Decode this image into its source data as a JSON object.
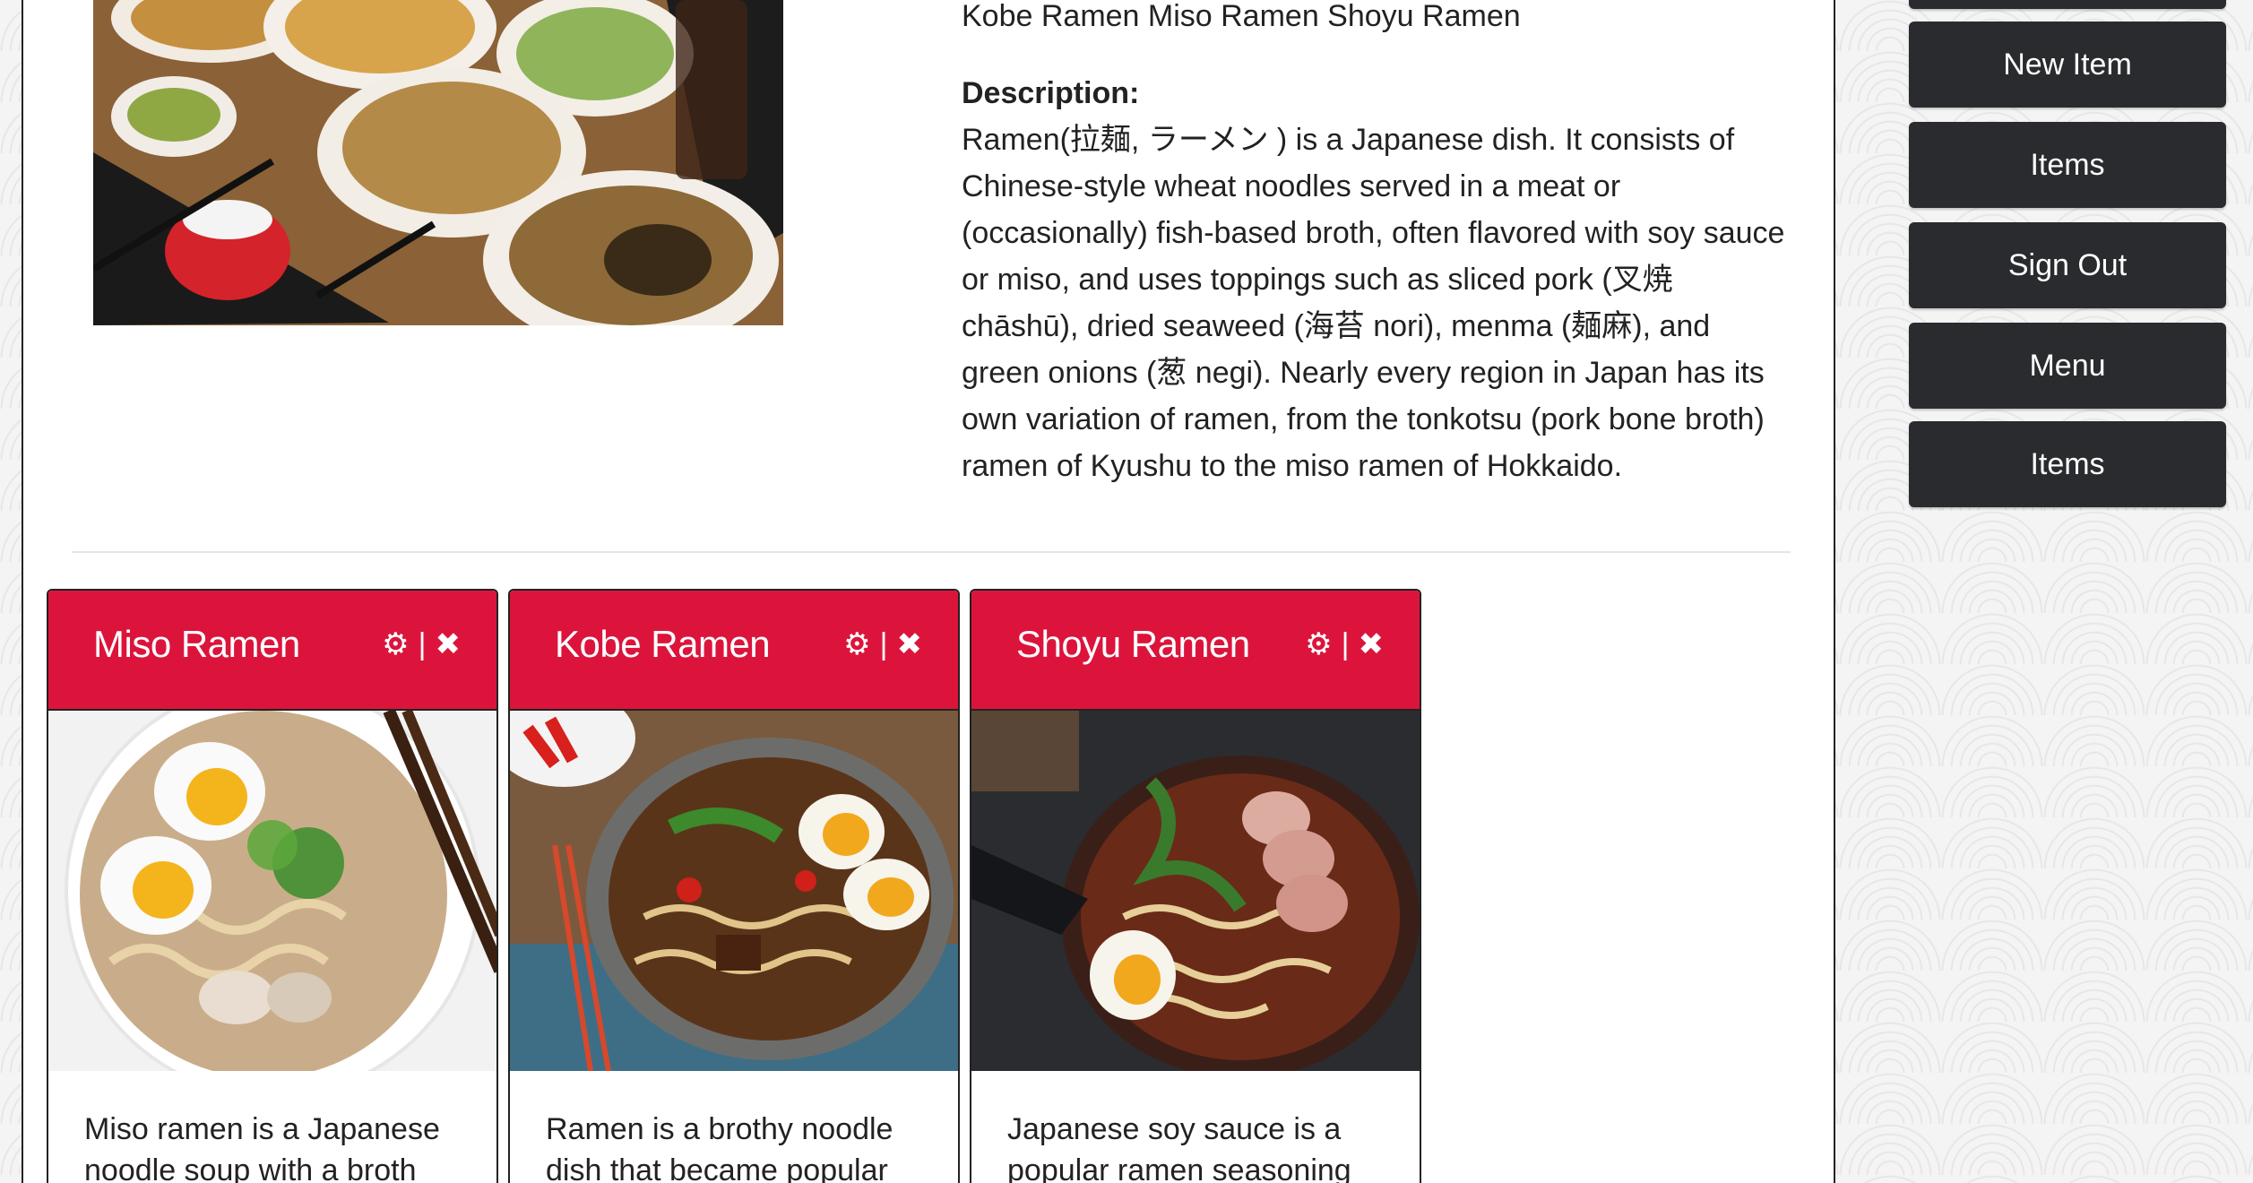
{
  "detail": {
    "item_names": "Kobe Ramen Miso Ramen Shoyu Ramen",
    "description_label": "Description:",
    "description_text": "Ramen(拉麺, ラーメン ) is a Japanese dish. It consists of Chinese-style wheat noodles served in a meat or (occasionally) fish-based broth, often flavored with soy sauce or miso, and uses toppings such as sliced pork (叉焼 chāshū), dried seaweed (海苔 nori), menma (麺麻), and green onions (葱 negi). Nearly every region in Japan has its own variation of ramen, from the tonkotsu (pork bone broth) ramen of Kyushu to the miso ramen of Hokkaido."
  },
  "cards": [
    {
      "title": "Miso Ramen",
      "text": "Miso ramen is a Japanese noodle soup with a broth"
    },
    {
      "title": "Kobe Ramen",
      "text": "Ramen is a brothy noodle dish that became popular"
    },
    {
      "title": "Shoyu Ramen",
      "text": "Japanese soy sauce is a popular ramen seasoning"
    }
  ],
  "card_actions": {
    "separator": "|",
    "edit_icon": "gear-icon",
    "delete_icon": "close-icon"
  },
  "sidebar": {
    "buttons": [
      "New Item",
      "Items",
      "Sign Out",
      "Menu",
      "Items"
    ]
  },
  "colors": {
    "card_header": "#dc143c",
    "sidebar_button": "#2a2b2e"
  }
}
